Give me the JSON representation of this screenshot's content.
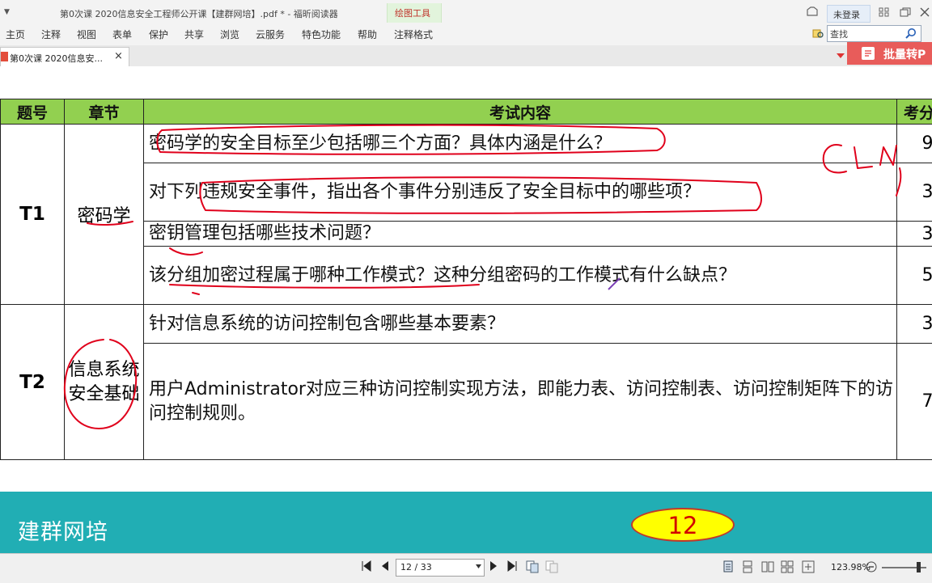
{
  "window": {
    "title": "第0次课 2020信息安全工程师公开课【建群网培】.pdf * - 福昕阅读器",
    "context_tab": "绘图工具",
    "login": "未登录"
  },
  "menu": [
    "主页",
    "注释",
    "视图",
    "表单",
    "保护",
    "共享",
    "浏览",
    "云服务",
    "特色功能",
    "帮助",
    "注释格式"
  ],
  "search": {
    "value": "查找"
  },
  "tab": {
    "label": "第0次课 2020信息安...",
    "close": "×"
  },
  "batch_button": "批量转P",
  "table": {
    "headers": [
      "题号",
      "章节",
      "考试内容",
      "考分"
    ],
    "groups": [
      {
        "id": "T1",
        "chapter": "密码学",
        "rows": [
          {
            "content": "密码学的安全目标至少包括哪三个方面？具体内涵是什么？",
            "score": "9"
          },
          {
            "content": "对下列违规安全事件，指出各个事件分别违反了安全目标中的哪些项？",
            "score": "3"
          },
          {
            "content": "密钥管理包括哪些技术问题？",
            "score": "3"
          },
          {
            "content": "该分组加密过程属于哪种工作模式？这种分组密码的工作模式有什么缺点？",
            "score": "5"
          }
        ]
      },
      {
        "id": "T2",
        "chapter": "信息系统安全基础",
        "rows": [
          {
            "content": "针对信息系统的访问控制包含哪些基本要素？",
            "score": "3"
          },
          {
            "content": "用户Administrator对应三种访问控制实现方法，即能力表、访问控制表、访问控制矩阵下的访问控制规则。",
            "score": "7"
          }
        ]
      }
    ]
  },
  "footer": {
    "brand": "建群网培",
    "page_badge": "12"
  },
  "status": {
    "page": "12 / 33",
    "zoom": "123.98%"
  },
  "colors": {
    "header_green": "#92d050",
    "footer_teal": "#21aeb4",
    "badge_yellow": "#ffff00",
    "annotation_red": "#e0001b"
  }
}
